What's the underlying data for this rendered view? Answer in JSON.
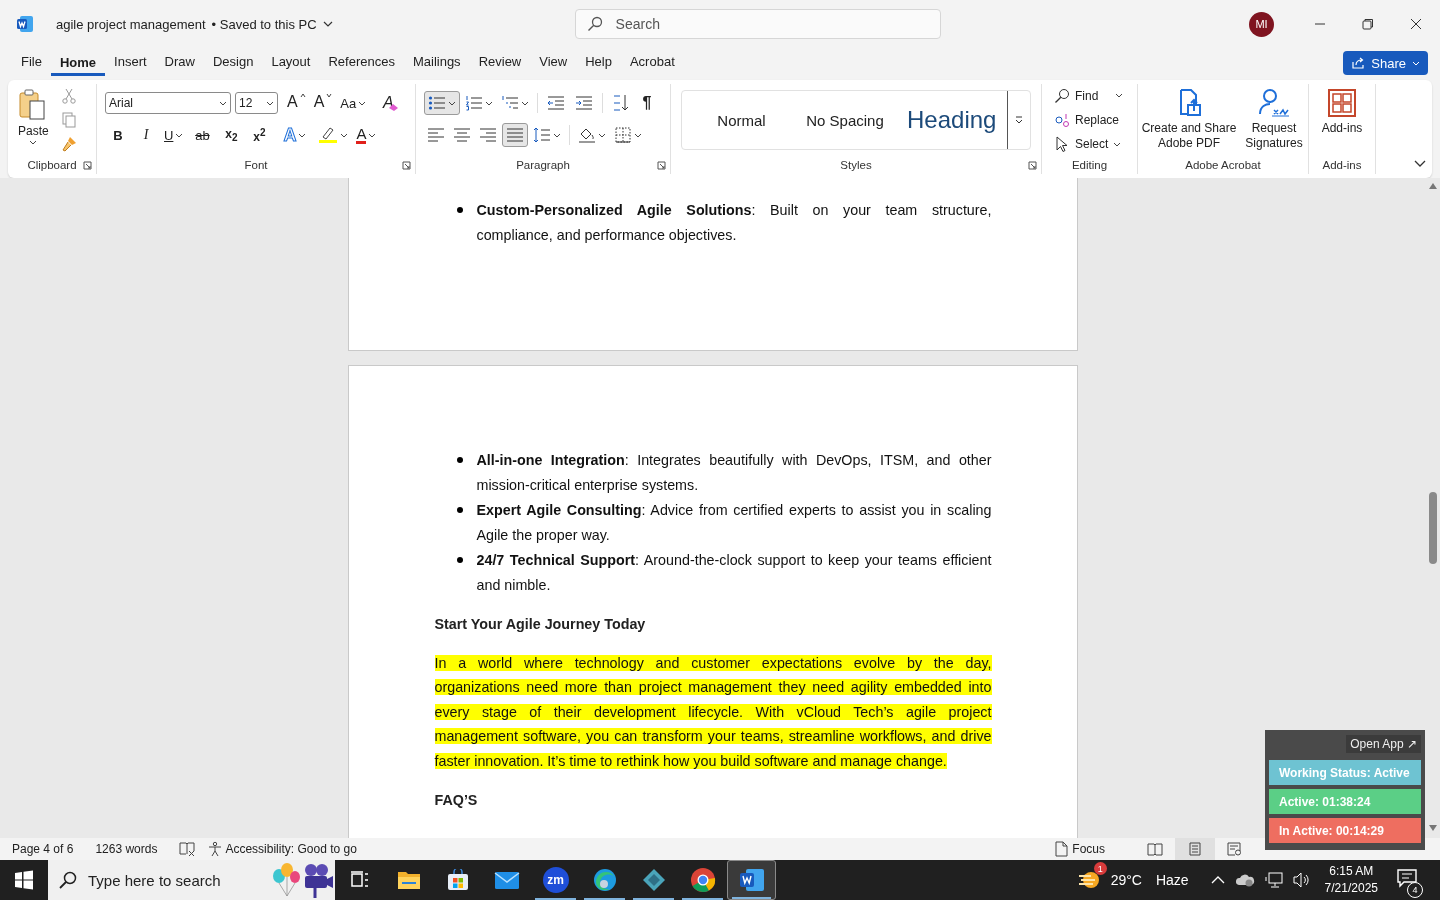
{
  "title_bar": {
    "document": "agile project management",
    "save_status": "•  Saved to this PC",
    "search_placeholder": "Search",
    "avatar": "MI"
  },
  "menu_tabs": [
    {
      "label": "File",
      "selected": false
    },
    {
      "label": "Home",
      "selected": true
    },
    {
      "label": "Insert",
      "selected": false
    },
    {
      "label": "Draw",
      "selected": false
    },
    {
      "label": "Design",
      "selected": false
    },
    {
      "label": "Layout",
      "selected": false
    },
    {
      "label": "References",
      "selected": false
    },
    {
      "label": "Mailings",
      "selected": false
    },
    {
      "label": "Review",
      "selected": false
    },
    {
      "label": "View",
      "selected": false
    },
    {
      "label": "Help",
      "selected": false
    },
    {
      "label": "Acrobat",
      "selected": false
    }
  ],
  "share": "Share",
  "ribbon": {
    "clipboard": {
      "paste": "Paste",
      "group": "Clipboard"
    },
    "font": {
      "family": "Arial",
      "size": "12",
      "group": "Font",
      "tools": [
        {
          "kind": "grow",
          "label": "A"
        },
        {
          "kind": "shrink",
          "label": "A"
        },
        {
          "kind": "case",
          "label": "Aa"
        },
        {
          "kind": "clear",
          "label": "A"
        },
        {
          "kind": "bold",
          "label": "B"
        },
        {
          "kind": "italic",
          "label": "I"
        },
        {
          "kind": "underline",
          "label": "U"
        },
        {
          "kind": "strike",
          "label": "ab"
        },
        {
          "kind": "subscript",
          "label": "x$_{2}$"
        },
        {
          "kind": "superscript",
          "label": "x$^{2}$"
        },
        {
          "kind": "effects",
          "label": "A"
        },
        {
          "kind": "highlight"
        },
        {
          "kind": "color",
          "label": "A"
        }
      ]
    },
    "paragraph": {
      "group": "Paragraph",
      "show_marks": "¶",
      "bullets_selected": true,
      "alignment": [
        {
          "selected": false
        },
        {
          "selected": false
        },
        {
          "selected": false
        },
        {
          "selected": true
        }
      ]
    },
    "styles": {
      "group": "Styles",
      "items": [
        {
          "label": "Normal",
          "kind": "normal"
        },
        {
          "label": "No Spacing",
          "kind": "normal"
        },
        {
          "label": "Heading",
          "kind": "heading"
        }
      ]
    },
    "editing": {
      "group": "Editing",
      "find": "Find",
      "replace": "Replace",
      "select": "Select"
    },
    "acrobat": {
      "group": "Adobe Acrobat",
      "create": "Create and Share Adobe PDF",
      "request": "Request Signatures"
    },
    "addins": {
      "group": "Add-ins",
      "button": "Add-ins"
    }
  },
  "document": {
    "page_top": [
      {
        "kind": "bullet",
        "text": "**Custom-Personalized Agile Solutions**: Built on your team structure, compliance, and performance objectives."
      }
    ],
    "page_bottom": [
      {
        "kind": "bullet",
        "text": "**All-in-one Integration**: Integrates beautifully with DevOps, ITSM, and other mission-critical enterprise systems."
      },
      {
        "kind": "bullet",
        "text": "**Expert Agile Consulting**: Advice from certified experts to assist you in scaling Agile the proper way."
      },
      {
        "kind": "bullet",
        "text": "**24/7 Technical Support**: Around-the-clock support to keep your teams efficient and nimble."
      },
      {
        "kind": "heading",
        "text": "Start Your Agile Journey Today"
      },
      {
        "kind": "highlight",
        "text": "In a world where technology and customer expectations evolve by the day, organizations need more than project management they need agility embedded into every stage of their development lifecycle. With vCloud Tech’s agile project management software, you can transform your teams, streamline workflows, and drive faster innovation. It’s time to rethink how you build software and manage change."
      },
      {
        "kind": "heading",
        "text": "FAQ’S"
      }
    ]
  },
  "status_bar": {
    "page": "Page 4 of 6",
    "words": "1263 words",
    "accessibility": "Accessibility: Good to go",
    "focus": "Focus",
    "views": [
      {
        "kind": "read",
        "selected": false
      },
      {
        "kind": "print",
        "selected": true
      },
      {
        "kind": "web",
        "selected": false
      }
    ]
  },
  "taskbar": {
    "search_placeholder": "Type here to search",
    "apps": [
      {
        "kind": "task_view",
        "running": false,
        "selected": false
      },
      {
        "kind": "explorer",
        "running": false,
        "selected": false
      },
      {
        "kind": "store",
        "running": false,
        "selected": false
      },
      {
        "kind": "mail",
        "running": false,
        "selected": false
      },
      {
        "kind": "zoom",
        "label": "zm",
        "running": true,
        "selected": false
      },
      {
        "kind": "edge",
        "running": true,
        "selected": false
      },
      {
        "kind": "app",
        "running": true,
        "selected": false
      },
      {
        "kind": "chrome",
        "running": true,
        "selected": false
      },
      {
        "kind": "word",
        "running": true,
        "selected": true
      }
    ],
    "weather_badge": "1",
    "temperature": "29°C",
    "weather": "Haze",
    "time": "6:15 AM",
    "date": "7/21/2025",
    "notifications": "4"
  },
  "tracker": {
    "open_app": "Open App ↗",
    "rows": [
      {
        "text": "Working Status: Active",
        "color": "#6ec3d2"
      },
      {
        "text": "Active: 01:38:24",
        "color": "#5bcf86"
      },
      {
        "text": "In Active: 00:14:29",
        "color": "#ee6e60"
      }
    ]
  }
}
